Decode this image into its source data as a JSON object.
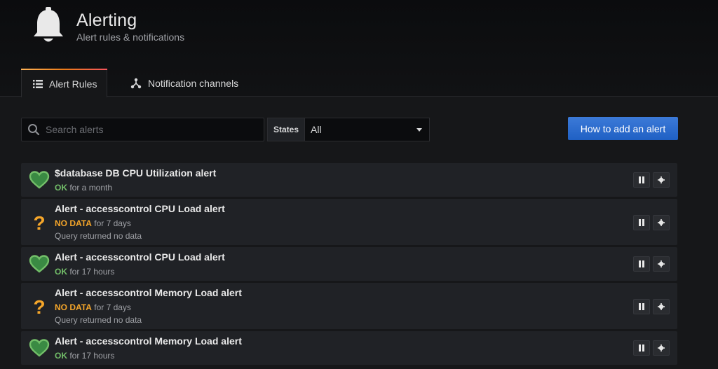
{
  "header": {
    "title": "Alerting",
    "subtitle": "Alert rules & notifications",
    "icon": "bell-icon"
  },
  "tabs": [
    {
      "label": "Alert Rules",
      "icon": "list-icon",
      "active": true
    },
    {
      "label": "Notification channels",
      "icon": "channels-icon",
      "active": false
    }
  ],
  "toolbar": {
    "search_placeholder": "Search alerts",
    "states_label": "States",
    "states_value": "All",
    "add_button_label": "How to add an alert"
  },
  "colors": {
    "ok": "#73bf69",
    "no_data": "#f5a62a",
    "primary_button": "#1f60c4",
    "tab_accent": "#eb7b18"
  },
  "alerts": [
    {
      "title": "$database DB CPU Utilization alert",
      "state": "OK",
      "duration": "for a month",
      "info": "",
      "icon": "heart-icon"
    },
    {
      "title": "Alert - accesscontrol CPU Load alert",
      "state": "NO DATA",
      "duration": "for 7 days",
      "info": "Query returned no data",
      "icon": "question-icon"
    },
    {
      "title": "Alert - accesscontrol CPU Load alert",
      "state": "OK",
      "duration": "for 17 hours",
      "info": "",
      "icon": "heart-icon"
    },
    {
      "title": "Alert - accesscontrol Memory Load alert",
      "state": "NO DATA",
      "duration": "for 7 days",
      "info": "Query returned no data",
      "icon": "question-icon"
    },
    {
      "title": "Alert - accesscontrol Memory Load alert",
      "state": "OK",
      "duration": "for 17 hours",
      "info": "",
      "icon": "heart-icon"
    }
  ]
}
